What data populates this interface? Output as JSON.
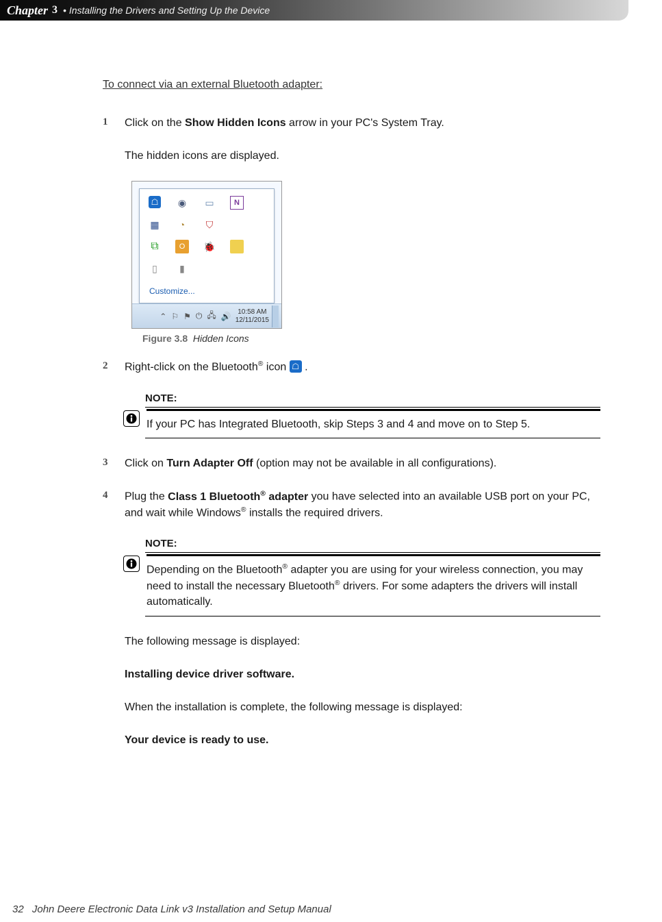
{
  "header": {
    "chapter_word": "Chapter",
    "chapter_num": "3",
    "bullet": "•",
    "title": "Installing the Drivers and Setting Up the Device"
  },
  "section_heading": "To connect via an external Bluetooth adapter:",
  "steps": {
    "s1": {
      "num": "1",
      "pre": "Click on the ",
      "bold": "Show Hidden Icons",
      "post": " arrow in your PC's System Tray."
    },
    "s1_sub": "The hidden icons are displayed.",
    "s2": {
      "num": "2",
      "pre": "Right-click on the Bluetooth",
      "sup": "®",
      "mid": " icon  ",
      "post": " ."
    },
    "s3": {
      "num": "3",
      "pre": "Click on ",
      "bold": "Turn Adapter Off",
      "post": " (option may not be available in all configurations)."
    },
    "s4": {
      "num": "4",
      "pre1": "Plug the ",
      "bold1": "Class 1 Bluetooth",
      "sup1": "®",
      "bold2": " adapter",
      "post1": " you have selected into an available USB port on your PC, and wait while Windows",
      "sup2": "®",
      "post2": " installs the required drivers."
    }
  },
  "figure": {
    "label": "Figure 3.8",
    "caption": "Hidden Icons",
    "customize": "Customize...",
    "time": "10:58 AM",
    "date": "12/11/2015"
  },
  "icons": {
    "bt": "bluetooth-icon",
    "globe": "globe-icon",
    "monitor": "monitor-icon",
    "onenote": "onenote-icon",
    "devmgr": "device-manager-icon",
    "sched": "schedule-icon",
    "shield": "shield-icon",
    "net": "network-icon",
    "orange": "app-icon",
    "bug": "ladybug-icon",
    "yellow": "app-icon2",
    "doc": "document-icon",
    "tablet": "tablet-icon"
  },
  "notes": {
    "label": "NOTE:",
    "n1": "If your PC has Integrated Bluetooth, skip Steps 3 and 4 and move on to Step 5.",
    "n2_p1": "Depending on the Bluetooth",
    "n2_sup1": "®",
    "n2_p2": " adapter you are using for your wireless connection, you may need to install the necessary Bluetooth",
    "n2_sup2": "®",
    "n2_p3": " drivers. For some adapters the drivers will install automatically."
  },
  "tail": {
    "msg1_intro": "The following message is displayed:",
    "msg1": "Installing device driver software.",
    "msg2_intro": "When the installation is complete, the following message is displayed:",
    "msg2": "Your device is ready to use."
  },
  "footer": {
    "page": "32",
    "title": "John Deere Electronic Data Link v3 Installation and Setup Manual"
  }
}
